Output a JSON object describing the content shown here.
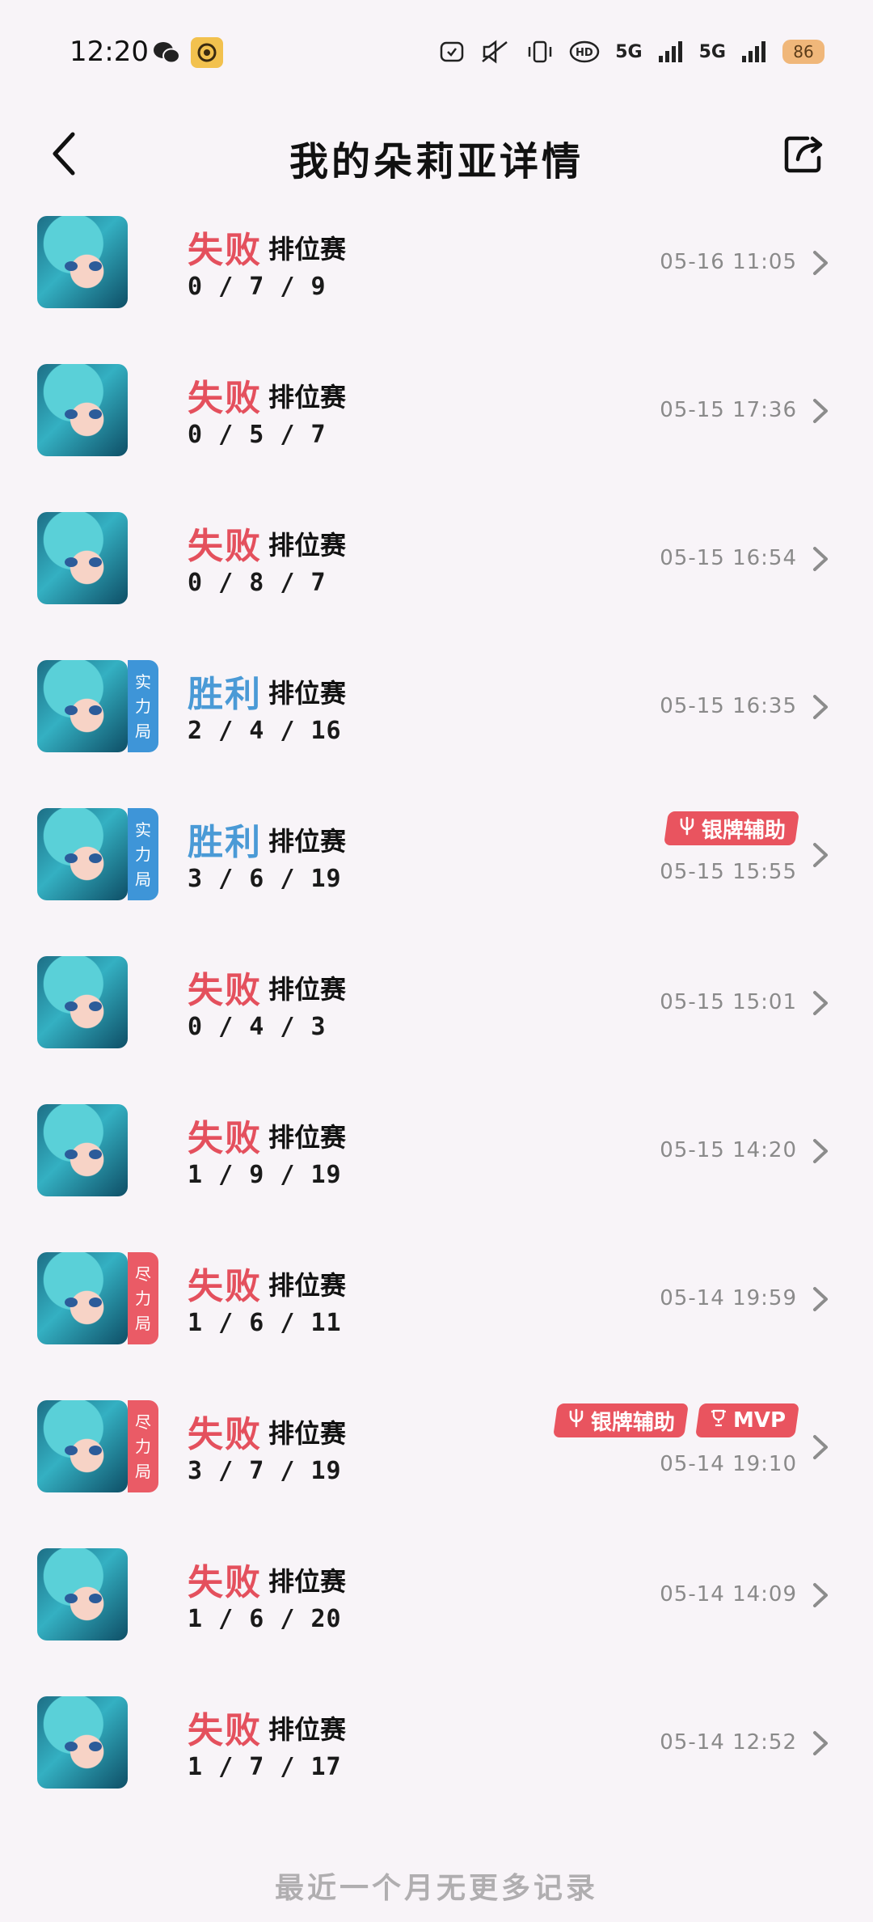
{
  "status_bar": {
    "time": "12:20",
    "network_1": "5G",
    "network_2": "5G",
    "battery": "86",
    "icons": [
      "wechat-icon",
      "app-icon",
      "alarm-icon",
      "mute-icon",
      "vibrate-icon",
      "hd-icon",
      "signal-icon",
      "battery-icon"
    ]
  },
  "header": {
    "title": "我的朵莉亚详情",
    "back_icon": "chevron-left-icon",
    "share_icon": "share-icon"
  },
  "matches": [
    {
      "result": "失败",
      "type": "loss",
      "mode": "排位赛",
      "kda": "0 / 7 / 9",
      "time": "05-16 11:05",
      "tag": "",
      "badges": []
    },
    {
      "result": "失败",
      "type": "loss",
      "mode": "排位赛",
      "kda": "0 / 5 / 7",
      "time": "05-15 17:36",
      "tag": "",
      "badges": []
    },
    {
      "result": "失败",
      "type": "loss",
      "mode": "排位赛",
      "kda": "0 / 8 / 7",
      "time": "05-15 16:54",
      "tag": "",
      "badges": []
    },
    {
      "result": "胜利",
      "type": "win",
      "mode": "排位赛",
      "kda": "2 / 4 / 16",
      "time": "05-15 16:35",
      "tag": "实力局",
      "tag_color": "blue",
      "badges": []
    },
    {
      "result": "胜利",
      "type": "win",
      "mode": "排位赛",
      "kda": "3 / 6 / 19",
      "time": "05-15 15:55",
      "tag": "实力局",
      "tag_color": "blue",
      "badges": [
        "银牌辅助"
      ]
    },
    {
      "result": "失败",
      "type": "loss",
      "mode": "排位赛",
      "kda": "0 / 4 / 3",
      "time": "05-15 15:01",
      "tag": "",
      "badges": []
    },
    {
      "result": "失败",
      "type": "loss",
      "mode": "排位赛",
      "kda": "1 / 9 / 19",
      "time": "05-15 14:20",
      "tag": "",
      "badges": []
    },
    {
      "result": "失败",
      "type": "loss",
      "mode": "排位赛",
      "kda": "1 / 6 / 11",
      "time": "05-14 19:59",
      "tag": "尽力局",
      "tag_color": "red",
      "badges": []
    },
    {
      "result": "失败",
      "type": "loss",
      "mode": "排位赛",
      "kda": "3 / 7 / 19",
      "time": "05-14 19:10",
      "tag": "尽力局",
      "tag_color": "red",
      "badges": [
        "银牌辅助",
        "MVP"
      ]
    },
    {
      "result": "失败",
      "type": "loss",
      "mode": "排位赛",
      "kda": "1 / 6 / 20",
      "time": "05-14 14:09",
      "tag": "",
      "badges": []
    },
    {
      "result": "失败",
      "type": "loss",
      "mode": "排位赛",
      "kda": "1 / 7 / 17",
      "time": "05-14 12:52",
      "tag": "",
      "badges": []
    }
  ],
  "footer": {
    "text": "最近一个月无更多记录"
  },
  "colors": {
    "background": "#f8f4f8",
    "loss": "#e4505d",
    "win": "#4a9ad6",
    "tag_blue": "#3e95d8",
    "tag_red": "#ea5b66",
    "badge": "#e9545f",
    "time": "#8a8a8a"
  }
}
